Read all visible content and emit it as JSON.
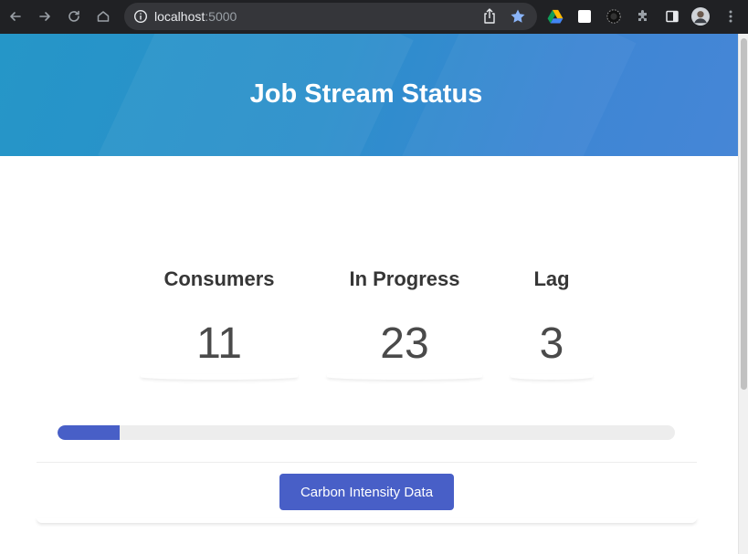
{
  "browser": {
    "url_host": "localhost",
    "url_port": ":5000"
  },
  "page": {
    "title": "Job Stream Status",
    "stats": [
      {
        "label": "Consumers",
        "value": "11"
      },
      {
        "label": "In Progress",
        "value": "23"
      },
      {
        "label": "Lag",
        "value": "3"
      }
    ],
    "progress_fraction": 0.1,
    "button_label": "Carbon Intensity Data"
  },
  "colors": {
    "accent": "#485fc7",
    "hero_start": "#2596c8",
    "hero_end": "#4686d6"
  },
  "icons": [
    "back-icon",
    "forward-icon",
    "reload-icon",
    "home-icon",
    "info-icon",
    "share-icon",
    "star-icon",
    "drive-icon",
    "extension-square-icon",
    "extension-circle-icon",
    "puzzle-icon",
    "side-panel-icon",
    "avatar",
    "menu-icon"
  ]
}
